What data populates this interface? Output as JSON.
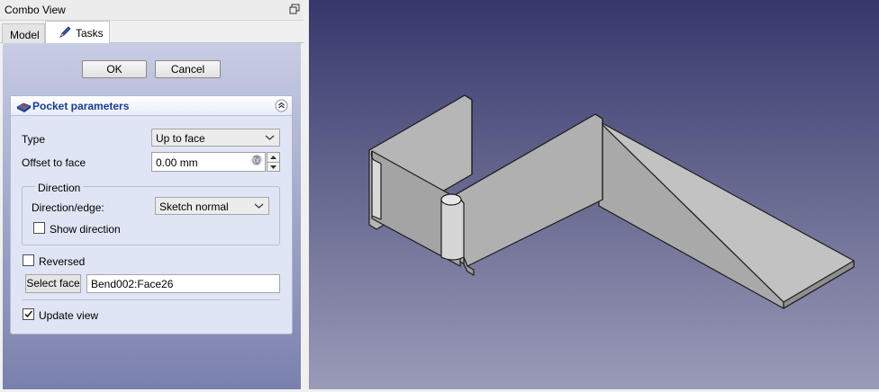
{
  "combo_view": {
    "title": "Combo View",
    "tabs": [
      {
        "label": "Model"
      },
      {
        "label": "Tasks"
      }
    ]
  },
  "dialog": {
    "ok_label": "OK",
    "cancel_label": "Cancel"
  },
  "pocket": {
    "title": "Pocket parameters",
    "type_label": "Type",
    "type_value": "Up to face",
    "offset_label": "Offset to face",
    "offset_value": "0.00 mm",
    "direction_group": "Direction",
    "direction_edge_label": "Direction/edge:",
    "direction_edge_value": "Sketch normal",
    "show_direction_label": "Show direction",
    "show_direction_checked": false,
    "reversed_label": "Reversed",
    "reversed_checked": false,
    "select_face_label": "Select face",
    "face_value": "Bend002:Face26",
    "update_view_label": "Update view",
    "update_view_checked": true
  },
  "icons": {
    "tasks_tab": "pencil-icon",
    "panel": "pocket-icon",
    "collapse": "chevron-up-icon",
    "float": "float-window-icon"
  },
  "colors": {
    "panel_title": "#1a3d8f",
    "viewport_top": "#36386b",
    "viewport_bottom": "#9a9bb7",
    "model_face": "#c3c3c3"
  }
}
